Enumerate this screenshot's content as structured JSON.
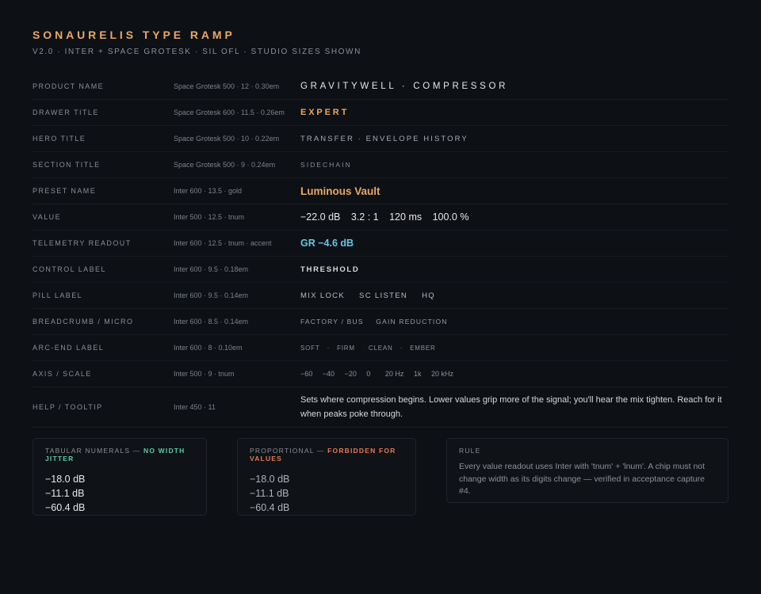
{
  "header": {
    "title": "SONAURELIS TYPE RAMP",
    "subtitle": "V2.0 · INTER + SPACE GROTESK · SIL OFL · STUDIO SIZES SHOWN"
  },
  "rows": [
    {
      "label": "PRODUCT NAME",
      "spec": "Space Grotesk 500 · 12 · 0.30em",
      "sample": "GRAVITYWELL · COMPRESSOR"
    },
    {
      "label": "DRAWER TITLE",
      "spec": "Space Grotesk 600 · 11.5 · 0.26em",
      "sample": "EXPERT"
    },
    {
      "label": "HERO TITLE",
      "spec": "Space Grotesk 500 · 10 · 0.22em",
      "sample": "TRANSFER · ENVELOPE HISTORY"
    },
    {
      "label": "SECTION TITLE",
      "spec": "Space Grotesk 500 · 9 · 0.24em",
      "sample": "SIDECHAIN"
    },
    {
      "label": "PRESET NAME",
      "spec": "Inter 600 · 13.5 · gold",
      "sample": "Luminous Vault"
    },
    {
      "label": "VALUE",
      "spec": "Inter 500 · 12.5 · tnum",
      "samples": [
        "−22.0 dB",
        "3.2 : 1",
        "120 ms",
        "100.0 %"
      ]
    },
    {
      "label": "TELEMETRY READOUT",
      "spec": "Inter 600 · 12.5 · tnum · accent",
      "sample": "GR −4.6 dB"
    },
    {
      "label": "CONTROL LABEL",
      "spec": "Inter 600 · 9.5 · 0.18em",
      "sample": "THRESHOLD"
    },
    {
      "label": "PILL LABEL",
      "spec": "Inter 600 · 9.5 · 0.14em",
      "samples": [
        "MIX LOCK",
        "SC LISTEN",
        "HQ"
      ]
    },
    {
      "label": "BREADCRUMB / MICRO",
      "spec": "Inter 600 · 8.5 · 0.14em",
      "samples": [
        "FACTORY / BUS",
        "GAIN REDUCTION"
      ]
    },
    {
      "label": "ARC-END LABEL",
      "spec": "Inter 600 · 8 · 0.10em",
      "samples": [
        "SOFT",
        "·",
        "FIRM",
        "CLEAN",
        "·",
        "EMBER"
      ]
    },
    {
      "label": "AXIS / SCALE",
      "spec": "Inter 500 · 9 · tnum",
      "samples": [
        "−60",
        "−40",
        "−20",
        "0",
        "20 Hz",
        "1k",
        "20 kHz"
      ]
    },
    {
      "label": "HELP / TOOLTIP",
      "spec": "Inter 450 · 11",
      "sample": "Sets where compression begins. Lower values grip more of the signal; you'll hear the mix tighten. Reach for it when peaks poke through."
    }
  ],
  "cards": {
    "tabular": {
      "title_prefix": "TABULAR NUMERALS — ",
      "title_accent": "NO WIDTH JITTER",
      "values": [
        "−18.0 dB",
        "−11.1 dB",
        "−60.4 dB"
      ]
    },
    "proportional": {
      "title_prefix": "PROPORTIONAL — ",
      "title_accent": "FORBIDDEN FOR VALUES",
      "values": [
        "−18.0 dB",
        "−11.1 dB",
        "−60.4 dB"
      ]
    },
    "rule": {
      "title": "RULE",
      "text": "Every value readout uses Inter with 'tnum' + 'lnum'. A chip must not change width as its digits change — verified in acceptance capture #4."
    }
  },
  "colors": {
    "background": "#0d1015",
    "gold": "#e8a866",
    "accent": "#6cc4e0",
    "green": "#5fc9a0",
    "orange": "#e27a55"
  }
}
